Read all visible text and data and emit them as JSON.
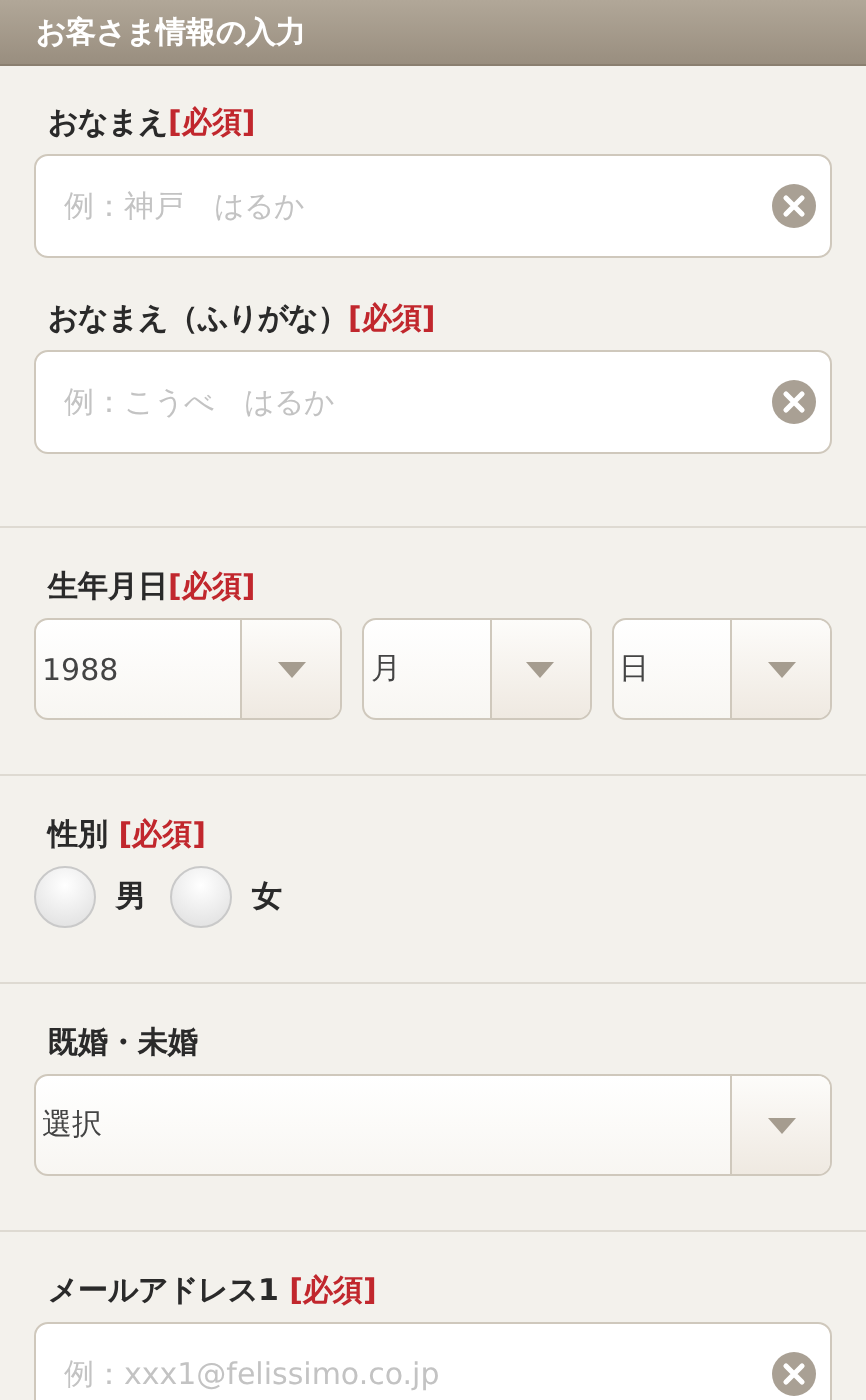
{
  "header": {
    "title": "お客さま情報の入力"
  },
  "sections": [
    {
      "kind": "text",
      "fields": [
        {
          "label": "おなまえ",
          "required": "[必須]",
          "placeholder": "例：神戸　はるか"
        },
        {
          "label": "おなまえ（ふりがな）",
          "required": "[必須]",
          "placeholder": "例：こうべ　はるか"
        }
      ]
    },
    {
      "kind": "date",
      "label": "生年月日",
      "required": "[必須]",
      "selects": [
        "1988",
        "月",
        "日"
      ]
    },
    {
      "kind": "radio",
      "label": "性別 ",
      "required": "[必須]",
      "options": [
        {
          "label": "男",
          "selected": false
        },
        {
          "label": "女",
          "selected": false
        }
      ]
    },
    {
      "kind": "select",
      "label": "既婚・未婚",
      "value": "選択"
    },
    {
      "kind": "text",
      "fields": [
        {
          "label": "メールアドレス1 ",
          "required": "[必須]",
          "placeholder": "例：xxx1@felissimo.co.jp"
        }
      ]
    }
  ]
}
